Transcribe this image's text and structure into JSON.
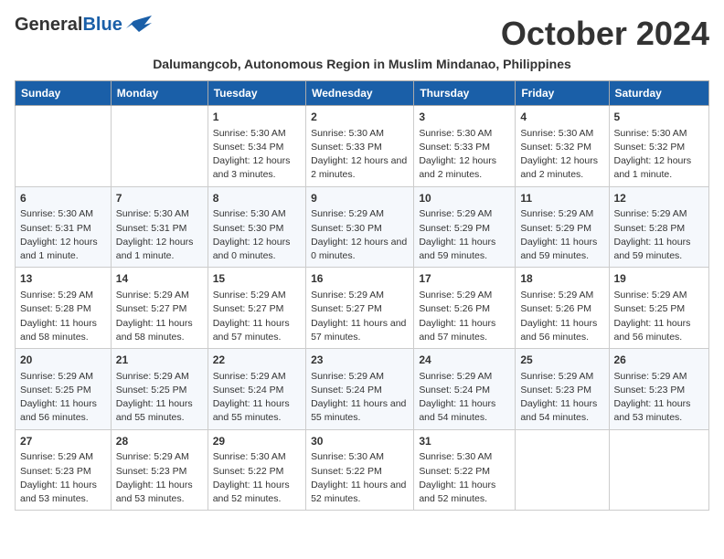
{
  "header": {
    "logo_line1": "General",
    "logo_line2": "Blue",
    "month_title": "October 2024",
    "subtitle": "Dalumangcob, Autonomous Region in Muslim Mindanao, Philippines"
  },
  "weekdays": [
    "Sunday",
    "Monday",
    "Tuesday",
    "Wednesday",
    "Thursday",
    "Friday",
    "Saturday"
  ],
  "weeks": [
    [
      {
        "day": "",
        "info": ""
      },
      {
        "day": "",
        "info": ""
      },
      {
        "day": "1",
        "info": "Sunrise: 5:30 AM\nSunset: 5:34 PM\nDaylight: 12 hours and 3 minutes."
      },
      {
        "day": "2",
        "info": "Sunrise: 5:30 AM\nSunset: 5:33 PM\nDaylight: 12 hours and 2 minutes."
      },
      {
        "day": "3",
        "info": "Sunrise: 5:30 AM\nSunset: 5:33 PM\nDaylight: 12 hours and 2 minutes."
      },
      {
        "day": "4",
        "info": "Sunrise: 5:30 AM\nSunset: 5:32 PM\nDaylight: 12 hours and 2 minutes."
      },
      {
        "day": "5",
        "info": "Sunrise: 5:30 AM\nSunset: 5:32 PM\nDaylight: 12 hours and 1 minute."
      }
    ],
    [
      {
        "day": "6",
        "info": "Sunrise: 5:30 AM\nSunset: 5:31 PM\nDaylight: 12 hours and 1 minute."
      },
      {
        "day": "7",
        "info": "Sunrise: 5:30 AM\nSunset: 5:31 PM\nDaylight: 12 hours and 1 minute."
      },
      {
        "day": "8",
        "info": "Sunrise: 5:30 AM\nSunset: 5:30 PM\nDaylight: 12 hours and 0 minutes."
      },
      {
        "day": "9",
        "info": "Sunrise: 5:29 AM\nSunset: 5:30 PM\nDaylight: 12 hours and 0 minutes."
      },
      {
        "day": "10",
        "info": "Sunrise: 5:29 AM\nSunset: 5:29 PM\nDaylight: 11 hours and 59 minutes."
      },
      {
        "day": "11",
        "info": "Sunrise: 5:29 AM\nSunset: 5:29 PM\nDaylight: 11 hours and 59 minutes."
      },
      {
        "day": "12",
        "info": "Sunrise: 5:29 AM\nSunset: 5:28 PM\nDaylight: 11 hours and 59 minutes."
      }
    ],
    [
      {
        "day": "13",
        "info": "Sunrise: 5:29 AM\nSunset: 5:28 PM\nDaylight: 11 hours and 58 minutes."
      },
      {
        "day": "14",
        "info": "Sunrise: 5:29 AM\nSunset: 5:27 PM\nDaylight: 11 hours and 58 minutes."
      },
      {
        "day": "15",
        "info": "Sunrise: 5:29 AM\nSunset: 5:27 PM\nDaylight: 11 hours and 57 minutes."
      },
      {
        "day": "16",
        "info": "Sunrise: 5:29 AM\nSunset: 5:27 PM\nDaylight: 11 hours and 57 minutes."
      },
      {
        "day": "17",
        "info": "Sunrise: 5:29 AM\nSunset: 5:26 PM\nDaylight: 11 hours and 57 minutes."
      },
      {
        "day": "18",
        "info": "Sunrise: 5:29 AM\nSunset: 5:26 PM\nDaylight: 11 hours and 56 minutes."
      },
      {
        "day": "19",
        "info": "Sunrise: 5:29 AM\nSunset: 5:25 PM\nDaylight: 11 hours and 56 minutes."
      }
    ],
    [
      {
        "day": "20",
        "info": "Sunrise: 5:29 AM\nSunset: 5:25 PM\nDaylight: 11 hours and 56 minutes."
      },
      {
        "day": "21",
        "info": "Sunrise: 5:29 AM\nSunset: 5:25 PM\nDaylight: 11 hours and 55 minutes."
      },
      {
        "day": "22",
        "info": "Sunrise: 5:29 AM\nSunset: 5:24 PM\nDaylight: 11 hours and 55 minutes."
      },
      {
        "day": "23",
        "info": "Sunrise: 5:29 AM\nSunset: 5:24 PM\nDaylight: 11 hours and 55 minutes."
      },
      {
        "day": "24",
        "info": "Sunrise: 5:29 AM\nSunset: 5:24 PM\nDaylight: 11 hours and 54 minutes."
      },
      {
        "day": "25",
        "info": "Sunrise: 5:29 AM\nSunset: 5:23 PM\nDaylight: 11 hours and 54 minutes."
      },
      {
        "day": "26",
        "info": "Sunrise: 5:29 AM\nSunset: 5:23 PM\nDaylight: 11 hours and 53 minutes."
      }
    ],
    [
      {
        "day": "27",
        "info": "Sunrise: 5:29 AM\nSunset: 5:23 PM\nDaylight: 11 hours and 53 minutes."
      },
      {
        "day": "28",
        "info": "Sunrise: 5:29 AM\nSunset: 5:23 PM\nDaylight: 11 hours and 53 minutes."
      },
      {
        "day": "29",
        "info": "Sunrise: 5:30 AM\nSunset: 5:22 PM\nDaylight: 11 hours and 52 minutes."
      },
      {
        "day": "30",
        "info": "Sunrise: 5:30 AM\nSunset: 5:22 PM\nDaylight: 11 hours and 52 minutes."
      },
      {
        "day": "31",
        "info": "Sunrise: 5:30 AM\nSunset: 5:22 PM\nDaylight: 11 hours and 52 minutes."
      },
      {
        "day": "",
        "info": ""
      },
      {
        "day": "",
        "info": ""
      }
    ]
  ]
}
